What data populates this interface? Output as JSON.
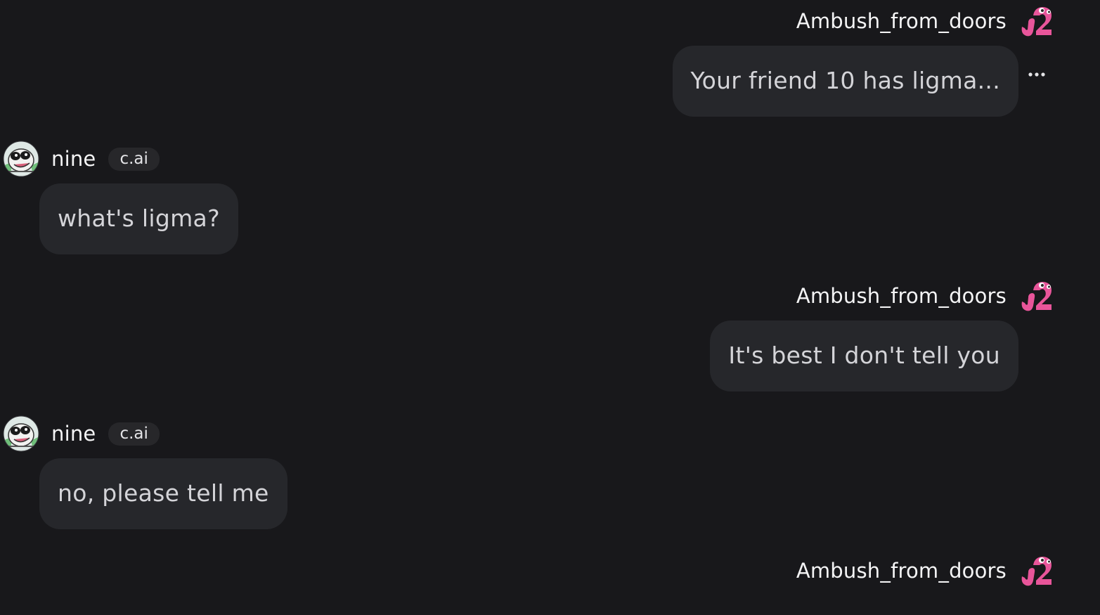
{
  "messages": [
    {
      "role": "user",
      "author": "Ambush_from_doors",
      "avatar": "pink-creature-avatar",
      "text": "Your friend 10 has ligma...",
      "has_more_menu": true
    },
    {
      "role": "bot",
      "author": "nine",
      "badge": "c.ai",
      "avatar": "cartoon-character-avatar",
      "text": "what's ligma?"
    },
    {
      "role": "user",
      "author": "Ambush_from_doors",
      "avatar": "pink-creature-avatar",
      "text": "It's best I don't tell you"
    },
    {
      "role": "bot",
      "author": "nine",
      "badge": "c.ai",
      "avatar": "cartoon-character-avatar",
      "text": "no, please tell me"
    },
    {
      "role": "user",
      "author": "Ambush_from_doors",
      "avatar": "pink-creature-avatar",
      "text": ""
    }
  ],
  "colors": {
    "background": "#18181b",
    "bubble": "#26272b",
    "badge": "#27272a",
    "user_avatar_accent": "#e8559a"
  },
  "icons": {
    "more_options": "ellipsis-icon"
  }
}
